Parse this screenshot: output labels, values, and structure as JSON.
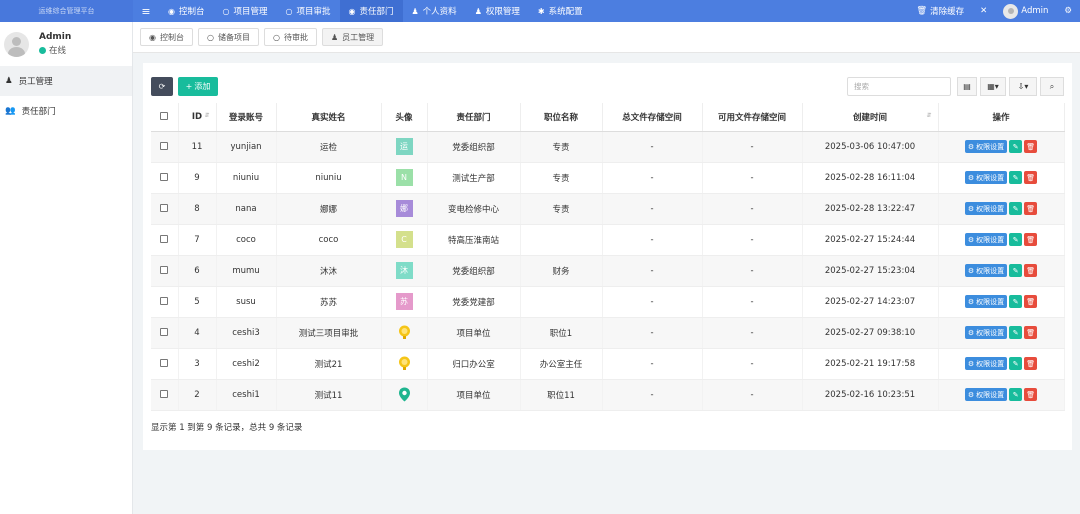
{
  "brand": "运维综合管理平台",
  "nav": [
    {
      "icon": "≡",
      "label": "",
      "icon_name": "menu-icon"
    },
    {
      "icon": "◉",
      "label": "控制台",
      "icon_name": "dashboard-icon"
    },
    {
      "icon": "○",
      "label": "项目管理",
      "icon_name": "circle-icon"
    },
    {
      "icon": "○",
      "label": "项目审批",
      "icon_name": "circle-icon"
    },
    {
      "icon": "◉",
      "label": "责任部门",
      "icon_name": "user-circle-icon"
    },
    {
      "icon": "♟",
      "label": "个人资料",
      "icon_name": "user-icon"
    },
    {
      "icon": "♟",
      "label": "权限管理",
      "icon_name": "group-icon"
    },
    {
      "icon": "✱",
      "label": "系统配置",
      "icon_name": "gear-icon"
    }
  ],
  "top_right": {
    "clear_cache": "清除缓存",
    "user": "Admin"
  },
  "sidebar": {
    "user_name": "Admin",
    "status": "在线",
    "items": [
      {
        "label": "员工管理"
      },
      {
        "label": "责任部门"
      }
    ]
  },
  "tabs": [
    {
      "label": "控制台"
    },
    {
      "label": "储备项目"
    },
    {
      "label": "待审批"
    },
    {
      "label": "员工管理"
    }
  ],
  "toolbar": {
    "add_label": "添加",
    "search_placeholder": "搜索"
  },
  "table": {
    "headers": [
      "ID",
      "登录账号",
      "真实姓名",
      "头像",
      "责任部门",
      "职位名称",
      "总文件存储空间",
      "可用文件存储空间",
      "创建时间",
      "操作"
    ],
    "rows": [
      {
        "id": "11",
        "account": "yunjian",
        "name": "运检",
        "avatar_text": "运",
        "avatar_color": "#7ed6c2",
        "avatar_type": "text",
        "dept": "党委组织部",
        "position": "专责",
        "total": "-",
        "avail": "-",
        "created": "2025-03-06 10:47:00"
      },
      {
        "id": "9",
        "account": "niuniu",
        "name": "niuniu",
        "avatar_text": "N",
        "avatar_color": "#9be0a8",
        "avatar_type": "text",
        "dept": "测试生产部",
        "position": "专责",
        "total": "-",
        "avail": "-",
        "created": "2025-02-28 16:11:04"
      },
      {
        "id": "8",
        "account": "nana",
        "name": "娜娜",
        "avatar_text": "娜",
        "avatar_color": "#a78bd9",
        "avatar_type": "text",
        "dept": "变电检修中心",
        "position": "专责",
        "total": "-",
        "avail": "-",
        "created": "2025-02-28 13:22:47"
      },
      {
        "id": "7",
        "account": "coco",
        "name": "coco",
        "avatar_text": "C",
        "avatar_color": "#d4e08c",
        "avatar_type": "text",
        "dept": "特高压淮南站",
        "position": "",
        "total": "-",
        "avail": "-",
        "created": "2025-02-27 15:24:44"
      },
      {
        "id": "6",
        "account": "mumu",
        "name": "沐沐",
        "avatar_text": "沐",
        "avatar_color": "#7fdcc8",
        "avatar_type": "text",
        "dept": "党委组织部",
        "position": "财务",
        "total": "-",
        "avail": "-",
        "created": "2025-02-27 15:23:04"
      },
      {
        "id": "5",
        "account": "susu",
        "name": "苏苏",
        "avatar_text": "苏",
        "avatar_color": "#e59acb",
        "avatar_type": "text",
        "dept": "党委党建部",
        "position": "",
        "total": "-",
        "avail": "-",
        "created": "2025-02-27 14:23:07"
      },
      {
        "id": "4",
        "account": "ceshi3",
        "name": "测试三项目审批",
        "avatar_text": "",
        "avatar_color": "#f5c518",
        "avatar_type": "trophy",
        "dept": "项目单位",
        "position": "职位1",
        "total": "-",
        "avail": "-",
        "created": "2025-02-27 09:38:10"
      },
      {
        "id": "3",
        "account": "ceshi2",
        "name": "测试21",
        "avatar_text": "",
        "avatar_color": "#f5c518",
        "avatar_type": "trophy",
        "dept": "归口办公室",
        "position": "办公室主任",
        "total": "-",
        "avail": "-",
        "created": "2025-02-21 19:17:58"
      },
      {
        "id": "2",
        "account": "ceshi1",
        "name": "测试11",
        "avatar_text": "",
        "avatar_color": "#1fb58f",
        "avatar_type": "pin",
        "dept": "项目单位",
        "position": "职位11",
        "total": "-",
        "avail": "-",
        "created": "2025-02-16 10:23:51"
      }
    ],
    "op_perm_label": "权限设置"
  },
  "footer": "显示第 1 到第 9 条记录，总共 9 条记录",
  "colors": {
    "topbar": "#4c7ee0",
    "primary": "#3c8dde",
    "success": "#18bc9c",
    "danger": "#e74c3c",
    "dark": "#444c5c"
  }
}
